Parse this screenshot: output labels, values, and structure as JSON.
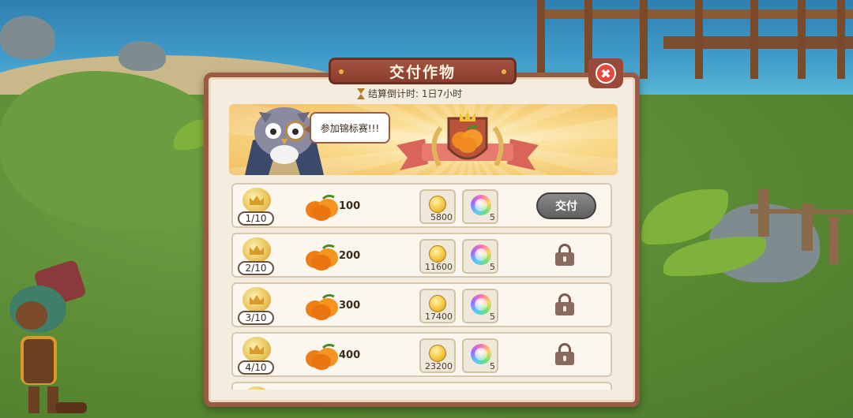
{
  "dialog": {
    "title": "交付作物",
    "close_icon": "close-icon",
    "countdown": "结算倒计时: 1日7小时",
    "speech": "参加锦标赛!!!"
  },
  "tasks": [
    {
      "rank": "1/10",
      "qty": "100",
      "coins": "5800",
      "orbs": "5",
      "state": "available",
      "button": "交付"
    },
    {
      "rank": "2/10",
      "qty": "200",
      "coins": "11600",
      "orbs": "5",
      "state": "locked"
    },
    {
      "rank": "3/10",
      "qty": "300",
      "coins": "17400",
      "orbs": "5",
      "state": "locked"
    },
    {
      "rank": "4/10",
      "qty": "400",
      "coins": "23200",
      "orbs": "5",
      "state": "locked"
    }
  ],
  "colors": {
    "panel_border": "#9b5a43",
    "title_bg": "#8a3d2d",
    "close_red": "#e64a3c",
    "banner": "#f8d886"
  }
}
